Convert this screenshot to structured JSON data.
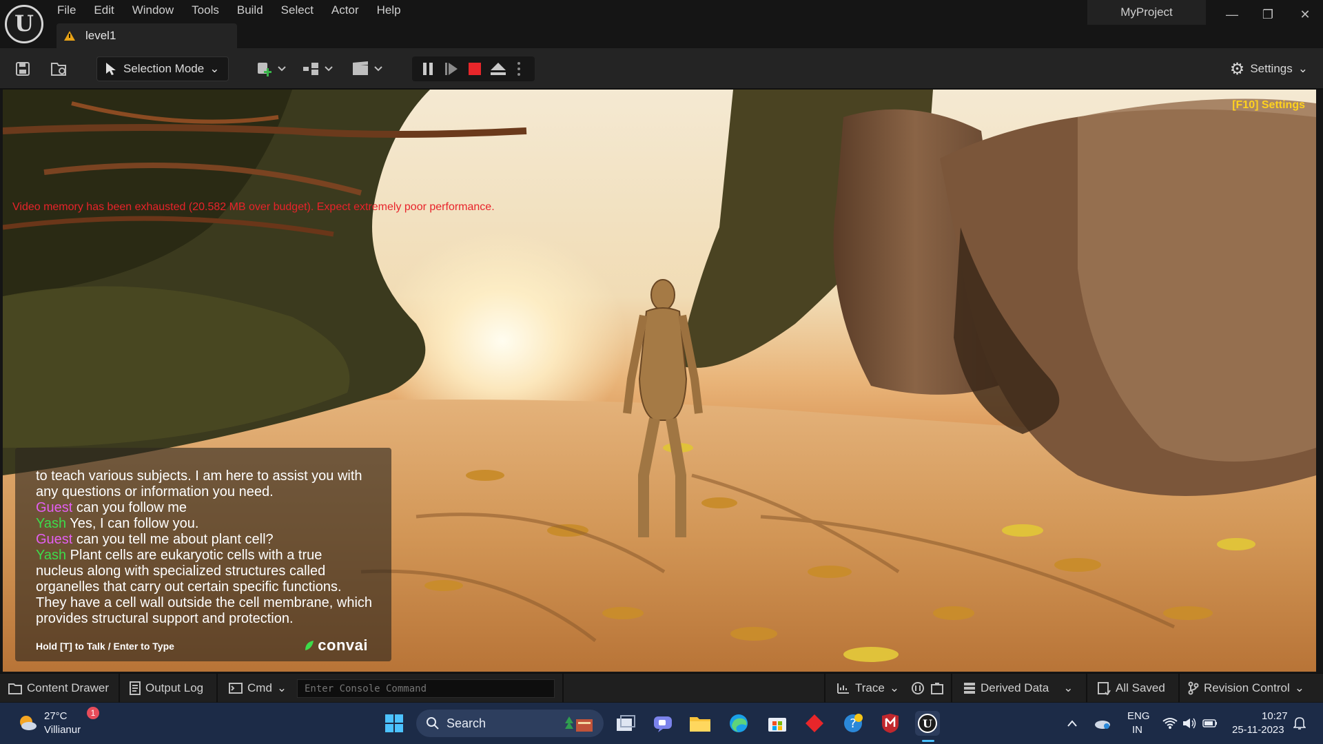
{
  "menu": [
    "File",
    "Edit",
    "Window",
    "Tools",
    "Build",
    "Select",
    "Actor",
    "Help"
  ],
  "level_tab": "level1",
  "project_name": "MyProject",
  "toolbar": {
    "selection_mode": "Selection Mode",
    "settings": "Settings"
  },
  "viewport": {
    "f10_settings": "[F10] Settings",
    "memory_warning": "Video memory has been exhausted (20.582 MB over budget). Expect extremely poor performance."
  },
  "chat": {
    "lines": [
      {
        "text": "to teach various subjects.  I am here to assist you with"
      },
      {
        "text": "any questions or information you need."
      },
      {
        "speaker": "Guest",
        "text": " can you follow me"
      },
      {
        "speaker": "Yash",
        "text": "  Yes, I can follow you."
      },
      {
        "speaker": "Guest",
        "text": " can you tell me about plant cell?"
      },
      {
        "speaker": "Yash",
        "text": "  Plant cells are eukaryotic cells with a true"
      },
      {
        "text": "nucleus along with specialized structures called"
      },
      {
        "text": "organelles that carry out certain specific functions."
      },
      {
        "text": "They have a cell wall outside the cell membrane, which"
      },
      {
        "text": "provides structural support and protection."
      }
    ],
    "hint": "Hold [T] to Talk / Enter to Type",
    "brand": "convai"
  },
  "statusbar": {
    "content_drawer": "Content Drawer",
    "output_log": "Output Log",
    "cmd": "Cmd",
    "console_placeholder": "Enter Console Command",
    "trace": "Trace",
    "derived_data": "Derived Data",
    "all_saved": "All Saved",
    "revision_control": "Revision Control"
  },
  "taskbar": {
    "weather_temp": "27°C",
    "weather_place": "Villianur",
    "weather_badge": "1",
    "search": "Search",
    "lang_top": "ENG",
    "lang_bottom": "IN",
    "time": "10:27",
    "date": "25-11-2023"
  },
  "colors": {
    "guest": "#e35ff1",
    "yash": "#3ddc4b",
    "warning": "#e8232a",
    "f10": "#ffd21e",
    "taskbar": "#1c2b47"
  }
}
